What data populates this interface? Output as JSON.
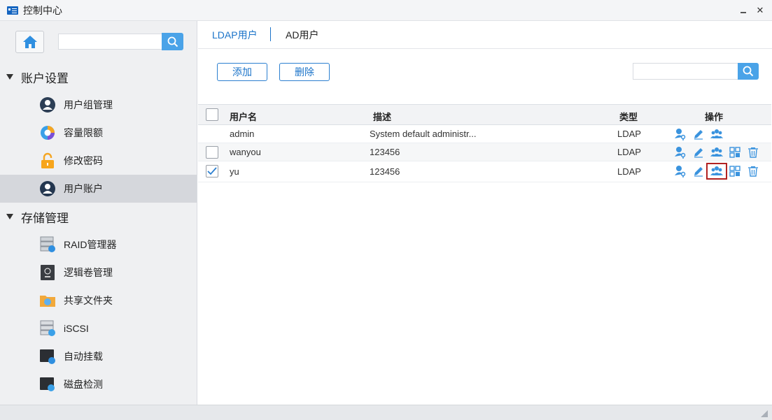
{
  "window": {
    "title": "控制中心"
  },
  "sidebar": {
    "search_placeholder": "",
    "sections": [
      {
        "label": "账户设置",
        "items": [
          {
            "label": "用户组管理",
            "icon": "user-group-icon"
          },
          {
            "label": "容量限额",
            "icon": "quota-pie-icon"
          },
          {
            "label": "修改密码",
            "icon": "lock-icon"
          },
          {
            "label": "用户账户",
            "icon": "user-account-icon",
            "active": true
          }
        ]
      },
      {
        "label": "存储管理",
        "items": [
          {
            "label": "RAID管理器",
            "icon": "raid-icon"
          },
          {
            "label": "逻辑卷管理",
            "icon": "lvm-icon"
          },
          {
            "label": "共享文件夹",
            "icon": "share-folder-icon"
          },
          {
            "label": "iSCSI",
            "icon": "iscsi-icon"
          },
          {
            "label": "自动挂载",
            "icon": "automount-icon"
          },
          {
            "label": "磁盘检测",
            "icon": "disk-check-icon"
          }
        ]
      }
    ]
  },
  "tabs": [
    {
      "label": "LDAP用户",
      "active": true
    },
    {
      "label": "AD用户",
      "active": false
    }
  ],
  "toolbar": {
    "add_label": "添加",
    "delete_label": "删除",
    "search_placeholder": ""
  },
  "table": {
    "headers": {
      "name": "用户名",
      "desc": "描述",
      "type": "类型",
      "ops": "操作"
    },
    "rows": [
      {
        "name": "admin",
        "desc": "System default administr...",
        "type": "LDAP",
        "checkbox": false,
        "checked": false,
        "ops": [
          "key-user-icon",
          "edit-icon",
          "group-icon"
        ]
      },
      {
        "name": "wanyou",
        "desc": "123456",
        "type": "LDAP",
        "checkbox": true,
        "checked": false,
        "ops": [
          "key-user-icon",
          "edit-icon",
          "group-icon",
          "apps-icon",
          "trash-icon"
        ]
      },
      {
        "name": "yu",
        "desc": "123456",
        "type": "LDAP",
        "checkbox": true,
        "checked": true,
        "ops": [
          "key-user-icon",
          "edit-icon",
          "group-icon",
          "apps-icon",
          "trash-icon"
        ]
      }
    ]
  },
  "colors": {
    "accent": "#1a73c9",
    "search_button": "#4aa3e8",
    "highlight_border": "#b22222"
  }
}
